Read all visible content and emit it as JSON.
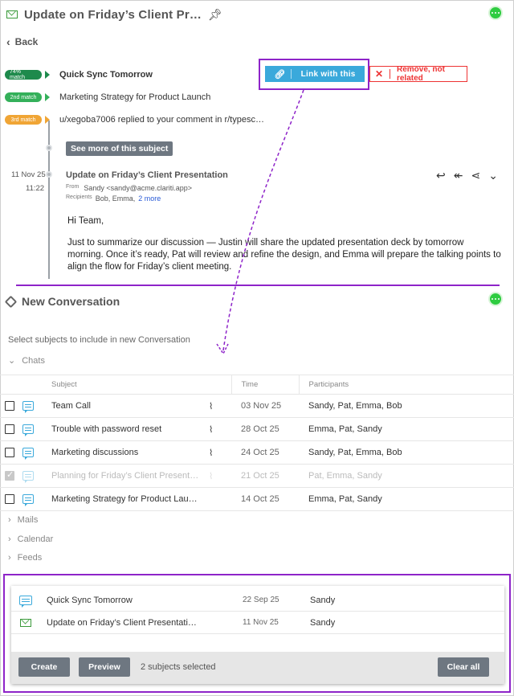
{
  "header": {
    "title": "Update on Friday’s Client Pr…",
    "back_label": "Back"
  },
  "matches": [
    {
      "badge": "74% match",
      "color": "#1e8a4c",
      "text": "Quick Sync Tomorrow"
    },
    {
      "badge": "2nd match",
      "color": "#34b05a",
      "text": "Marketing Strategy for Product Launch"
    },
    {
      "badge": "3rd match",
      "color": "#f0a535",
      "text": "u/xegoba7006 replied to your comment in r/typesc…"
    }
  ],
  "actions": {
    "link_label": "Link with this",
    "remove_label": "Remove, not related",
    "see_more_label": "See more of this subject"
  },
  "email": {
    "date": "11 Nov 25",
    "time": "11:22",
    "subject": "Update on Friday’s Client Presentation",
    "from_label": "From",
    "from_value": "Sandy <sandy@acme.clariti.app>",
    "recipients_label": "Recipients",
    "recipients_value": "Bob, Emma,",
    "more_link": "2 more",
    "greeting": "Hi Team,",
    "body": "Just to summarize our discussion — Justin will share the updated presentation deck by tomorrow morning. Once it’s ready, Pat will review and refine the design, and Emma will prepare the talking points to align the flow for Friday’s client meeting."
  },
  "new_conversation": {
    "title": "New Conversation",
    "instructions": "Select subjects to include in new Conversation",
    "chats_label": "Chats",
    "columns": {
      "subject": "Subject",
      "time": "Time",
      "participants": "Participants"
    },
    "rows": [
      {
        "subject": "Team Call",
        "time": "03 Nov 25",
        "participants": "Sandy, Pat, Emma, Bob",
        "checked": false,
        "faded": false
      },
      {
        "subject": "Trouble with password reset",
        "time": "28 Oct 25",
        "participants": "Emma, Pat, Sandy",
        "checked": false,
        "faded": false
      },
      {
        "subject": "Marketing discussions",
        "time": "24 Oct 25",
        "participants": "Sandy, Pat, Emma, Bob",
        "checked": false,
        "faded": false
      },
      {
        "subject": "Planning for Friday’s Client Present…",
        "time": "21 Oct 25",
        "participants": "Pat, Emma, Sandy",
        "checked": true,
        "faded": true
      },
      {
        "subject": "Marketing Strategy for Product Lau…",
        "time": "14 Oct 25",
        "participants": "Emma, Pat, Sandy",
        "checked": false,
        "faded": false
      }
    ],
    "sections": [
      "Mails",
      "Calendar",
      "Feeds"
    ]
  },
  "selected": {
    "items": [
      {
        "type": "chat",
        "subject": "Quick Sync Tomorrow",
        "time": "22 Sep 25",
        "participants": "Sandy"
      },
      {
        "type": "mail",
        "subject": "Update on Friday’s Client Presentati…",
        "time": "11 Nov 25",
        "participants": "Sandy"
      }
    ],
    "create_label": "Create",
    "preview_label": "Preview",
    "count_label": "2 subjects selected",
    "clear_label": "Clear all"
  },
  "colors": {
    "accent": "#3aa9db",
    "highlight": "#8e24c9",
    "danger": "#e33333",
    "mail": "#3a9a3a"
  }
}
